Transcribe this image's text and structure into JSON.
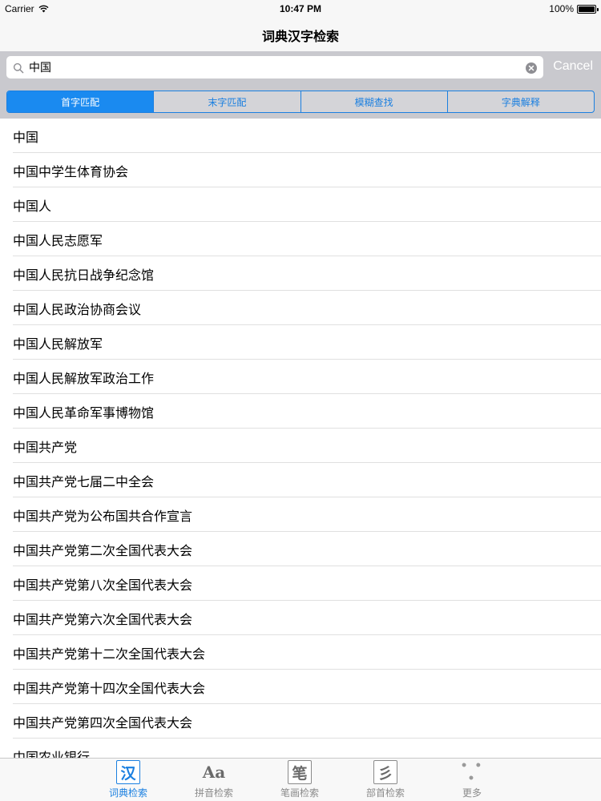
{
  "status": {
    "carrier": "Carrier",
    "time": "10:47 PM",
    "battery": "100%",
    "battery_level": 1.0
  },
  "nav": {
    "title": "词典汉字检索"
  },
  "search": {
    "value": "中国",
    "cancel_label": "Cancel"
  },
  "segments": [
    {
      "label": "首字匹配",
      "active": true
    },
    {
      "label": "末字匹配",
      "active": false
    },
    {
      "label": "模糊查找",
      "active": false
    },
    {
      "label": "字典解释",
      "active": false
    }
  ],
  "results": [
    "中国",
    "中国中学生体育协会",
    "中国人",
    "中国人民志愿军",
    "中国人民抗日战争纪念馆",
    "中国人民政治协商会议",
    "中国人民解放军",
    "中国人民解放军政治工作",
    "中国人民革命军事博物馆",
    "中国共产党",
    "中国共产党七届二中全会",
    "中国共产党为公布国共合作宣言",
    "中国共产党第二次全国代表大会",
    "中国共产党第八次全国代表大会",
    "中国共产党第六次全国代表大会",
    "中国共产党第十二次全国代表大会",
    "中国共产党第十四次全国代表大会",
    "中国共产党第四次全国代表大会",
    "中国农业银行"
  ],
  "tabs": [
    {
      "icon_text": "汉",
      "label": "词典检索",
      "icon": "han-character-icon"
    },
    {
      "icon_text": "Aa",
      "label": "拼音检索",
      "icon": "pinyin-icon"
    },
    {
      "icon_text": "笔",
      "label": "笔画检索",
      "icon": "stroke-icon"
    },
    {
      "icon_text": "彡",
      "label": "部首检索",
      "icon": "radical-icon"
    },
    {
      "icon_text": "• • •",
      "label": "更多",
      "icon": "more-icon"
    }
  ],
  "colors": {
    "accent": "#1a7fe0",
    "search_bar_bg": "#c9c9ce"
  }
}
